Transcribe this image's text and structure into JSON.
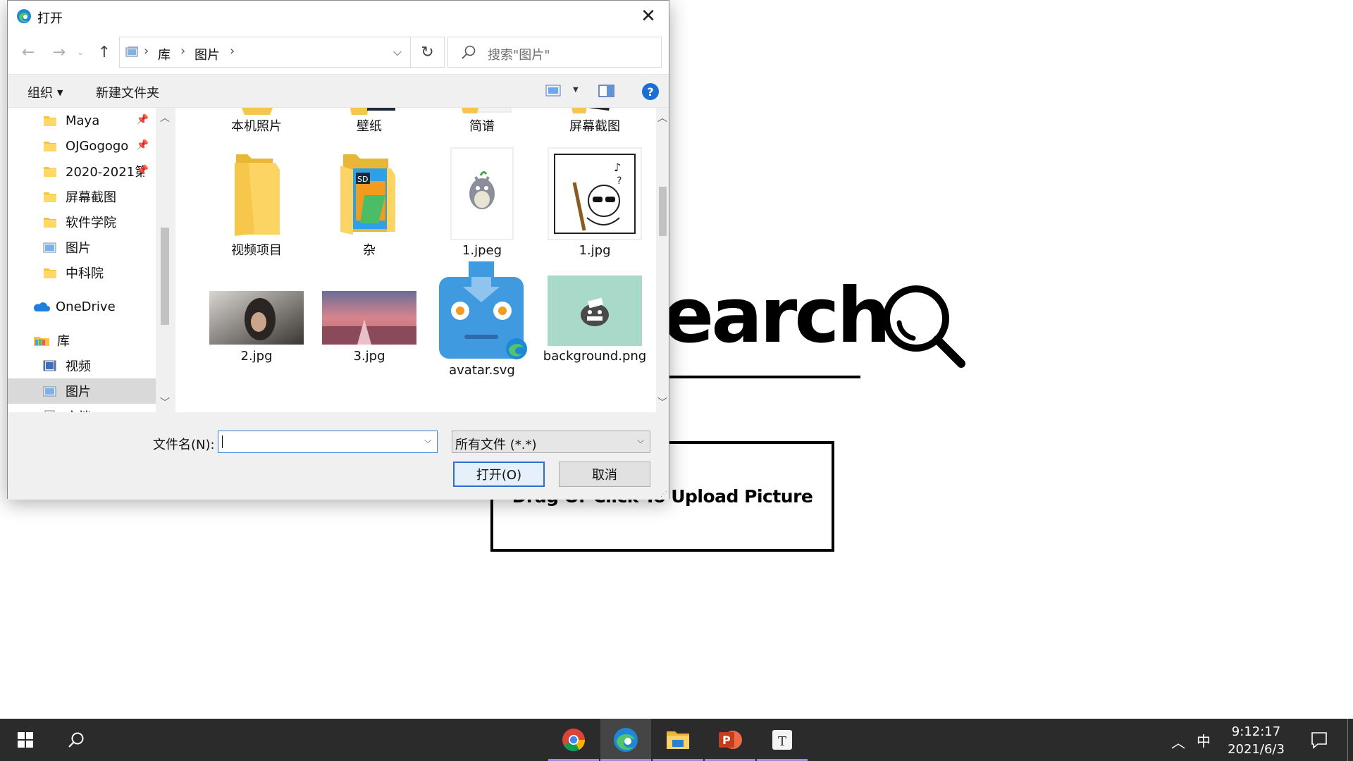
{
  "page": {
    "hero_title": "earch",
    "upload_text": "Drag Or Click To Upload Picture"
  },
  "dialog": {
    "title": "打开",
    "close_glyph": "✕",
    "breadcrumb": [
      "库",
      "图片"
    ],
    "search_placeholder": "搜索\"图片\"",
    "organize_label": "组织",
    "new_folder_label": "新建文件夹",
    "help_label": "?",
    "nav_items": [
      {
        "label": "Maya",
        "icon": "folder-icon",
        "pinned": true
      },
      {
        "label": "OJGogogo",
        "icon": "folder-icon",
        "pinned": true
      },
      {
        "label": "2020-2021第",
        "icon": "folder-icon",
        "pinned": true
      },
      {
        "label": "屏幕截图",
        "icon": "folder-icon",
        "pinned": false
      },
      {
        "label": "软件学院",
        "icon": "folder-icon",
        "pinned": false
      },
      {
        "label": "图片",
        "icon": "pictures-icon",
        "pinned": false
      },
      {
        "label": "中科院",
        "icon": "folder-icon",
        "pinned": false
      },
      {
        "label": "OneDrive",
        "icon": "cloud-icon",
        "pinned": false
      },
      {
        "label": "库",
        "icon": "library-icon",
        "pinned": false
      },
      {
        "label": "视频",
        "icon": "video-library-icon",
        "pinned": false
      },
      {
        "label": "图片",
        "icon": "pictures-icon",
        "pinned": false,
        "selected": true
      },
      {
        "label": "文档",
        "icon": "documents-icon",
        "pinned": false
      }
    ],
    "files": [
      {
        "name": "本机照片",
        "kind": "folder"
      },
      {
        "name": "壁纸",
        "kind": "folder"
      },
      {
        "name": "简谱",
        "kind": "folder"
      },
      {
        "name": "屏幕截图",
        "kind": "folder"
      },
      {
        "name": "视频项目",
        "kind": "folder"
      },
      {
        "name": "杂",
        "kind": "folder"
      },
      {
        "name": "1.jpeg",
        "kind": "image"
      },
      {
        "name": "1.jpg",
        "kind": "image"
      },
      {
        "name": "2.jpg",
        "kind": "image"
      },
      {
        "name": "3.jpg",
        "kind": "image"
      },
      {
        "name": "avatar.svg",
        "kind": "svg"
      },
      {
        "name": "background.png",
        "kind": "image"
      }
    ],
    "filename_label": "文件名(N):",
    "filename_value": "",
    "filter_value": "所有文件 (*.*)",
    "open_button": "打开(O)",
    "cancel_button": "取消"
  },
  "taskbar": {
    "apps": [
      "chrome-icon",
      "edge-icon",
      "file-explorer-icon",
      "powerpoint-icon",
      "typora-icon"
    ],
    "active_app": "edge-icon",
    "ime": "中",
    "time": "9:12:17",
    "date": "2021/6/3"
  },
  "colors": {
    "accent": "#2d6fd1",
    "taskbar": "#2b2b2b",
    "folder": "#f5c342",
    "selected_nav": "#d9d9d9"
  }
}
